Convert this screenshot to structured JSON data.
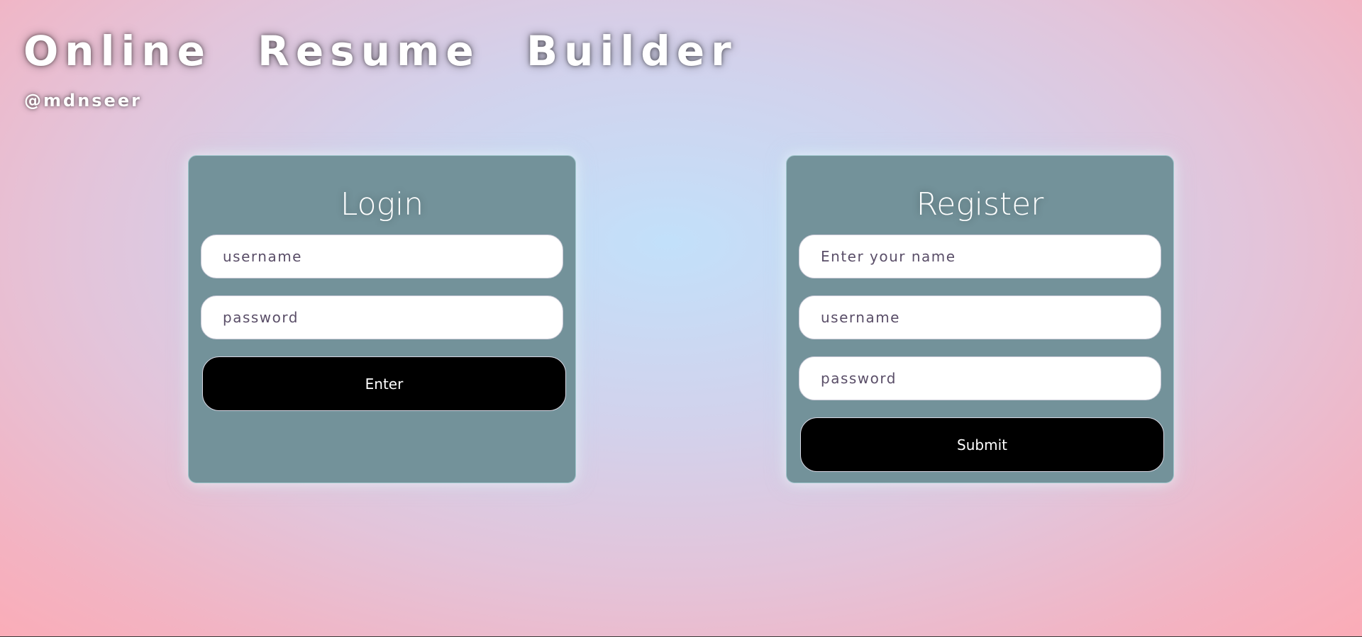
{
  "brand": {
    "title": "Online Resume Builder",
    "handle": "@mdnseer"
  },
  "login": {
    "title": "Login",
    "username_placeholder": "username",
    "password_placeholder": "password",
    "submit_label": "Enter"
  },
  "register": {
    "title": "Register",
    "name_placeholder": "Enter your name",
    "username_placeholder": "username",
    "password_placeholder": "password",
    "submit_label": "Submit"
  },
  "colors": {
    "card_background": "#73929a",
    "button_background": "#000000",
    "page_gradient_center": "#c2e0fa",
    "page_gradient_edge": "#fdaab4"
  }
}
